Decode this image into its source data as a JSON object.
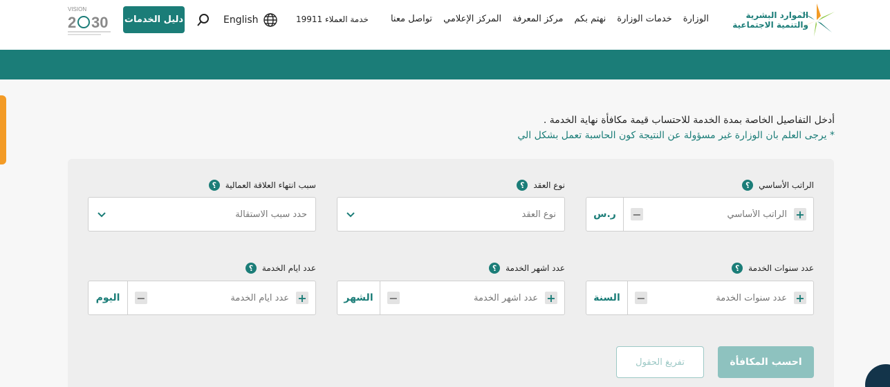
{
  "header": {
    "logo_line1": "الموارد البشرية",
    "logo_line2": "والتنمية الاجتماعية",
    "nav": [
      "الوزارة",
      "خدمات الوزارة",
      "نهتم بكم",
      "مركز المعرفة",
      "المركز الإعلامي",
      "تواصل معنا"
    ],
    "hotline": "خدمة العملاء 19911",
    "language": "English",
    "guide_button": "دليل الخدمات",
    "vision_label": "VISION 2030"
  },
  "intro": {
    "line1": "أدخل التفاصيل الخاصة بمدة الخدمة للاحتساب قيمة مكافأة نهاية الخدمة .",
    "line2": "* يرجى العلم بان الوزارة غير مسؤولة عن النتيجة كون الحاسبة تعمل بشكل الي"
  },
  "form": {
    "basic_salary": {
      "label": "الراتب الأساسي",
      "placeholder": "الراتب الأساسي",
      "unit": "ر.س"
    },
    "contract_type": {
      "label": "نوع العقد",
      "placeholder": "نوع العقد"
    },
    "termination_reason": {
      "label": "سبب انتهاء العلاقة العمالية",
      "placeholder": "حدد سبب الاستقالة"
    },
    "years": {
      "label": "عدد سنوات الخدمة",
      "placeholder": "عدد سنوات الخدمة",
      "unit": "السنة"
    },
    "months": {
      "label": "عدد اشهر الخدمة",
      "placeholder": "عدد اشهر الخدمة",
      "unit": "الشهر"
    },
    "days": {
      "label": "عدد ايام الخدمة",
      "placeholder": "عدد ايام الخدمة",
      "unit": "اليوم"
    },
    "help_symbol": "؟"
  },
  "actions": {
    "calculate": "احسب المكافأة",
    "clear": "تفريغ الحقول"
  },
  "colors": {
    "primary": "#1b7d78",
    "accent": "#f39b26"
  }
}
